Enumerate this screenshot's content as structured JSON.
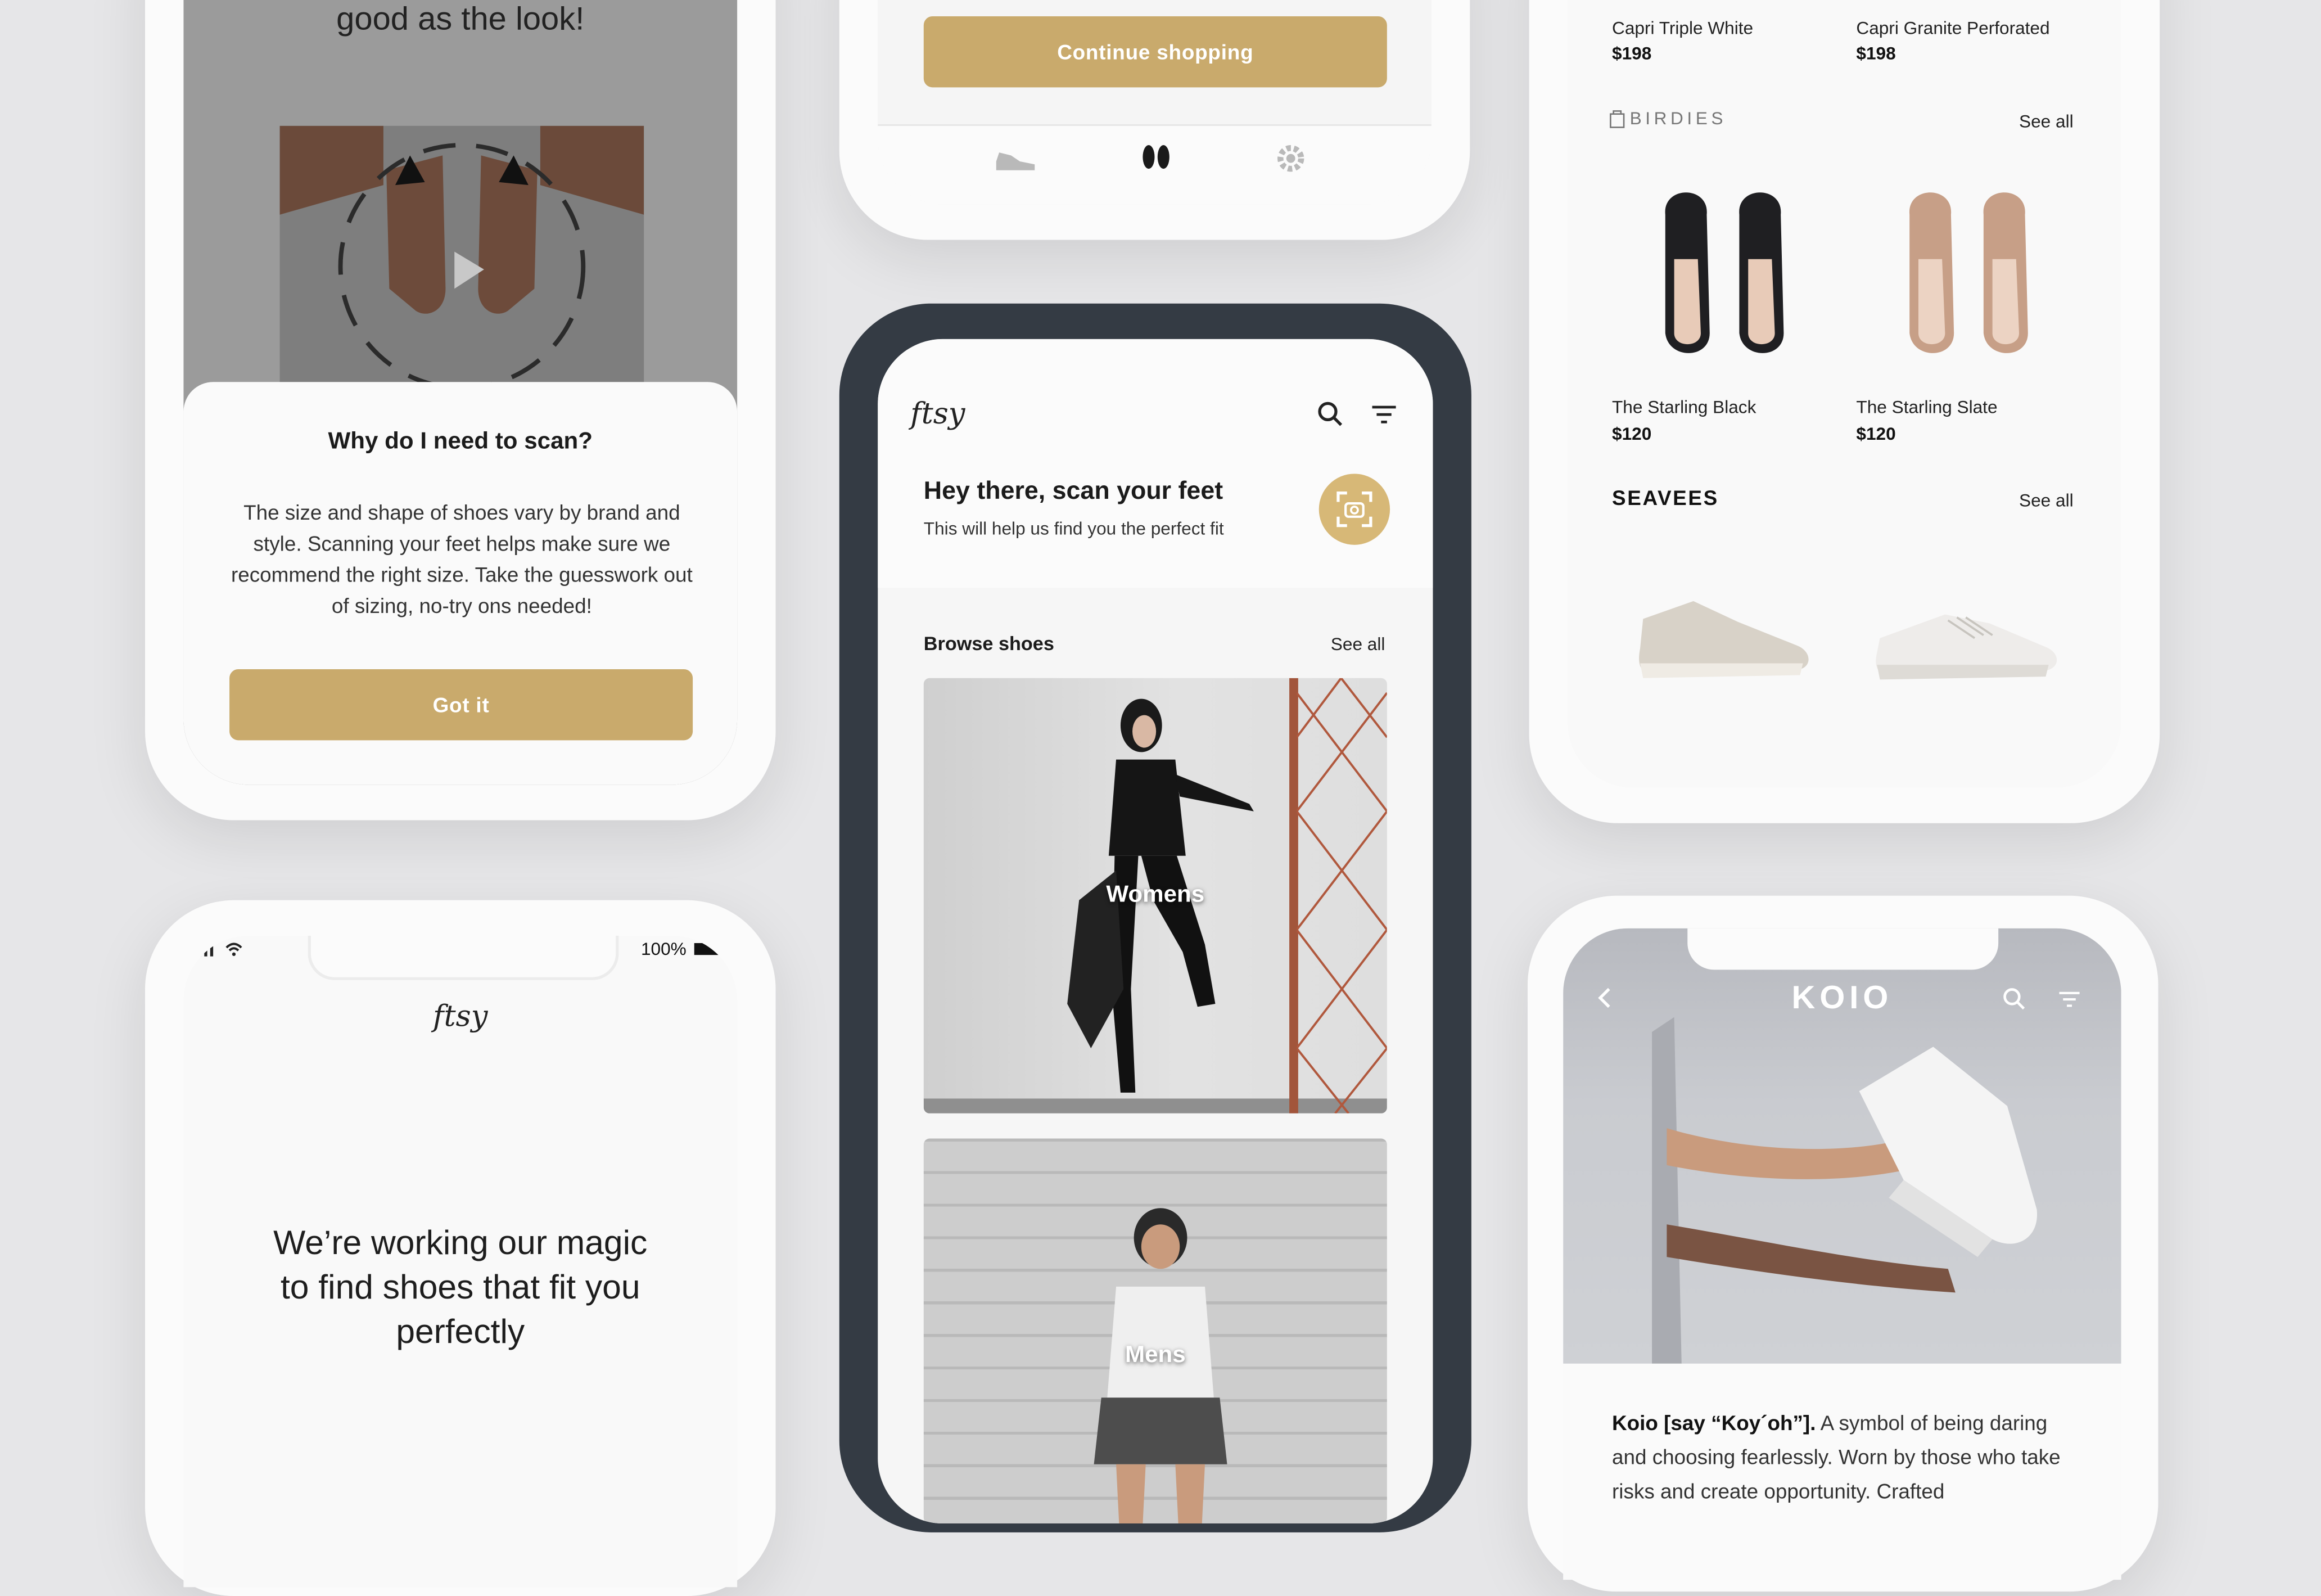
{
  "phone1": {
    "top_text": "good as the look!",
    "title": "Why do I need to scan?",
    "body": "The size and shape of shoes vary by brand and style. Scanning your feet helps make sure we recommend the right size. Take the guesswork out of sizing, no-try ons needed!",
    "button": "Got it"
  },
  "phone2": {
    "button": "Continue shopping",
    "nav_icons": [
      "shoe-icon",
      "feet-icon",
      "gear-icon"
    ]
  },
  "phone3": {
    "logo": "ftsy",
    "heading": "Hey there, scan your feet",
    "subheading": "This will help us find you the perfect fit",
    "section_title": "Browse shoes",
    "see_all": "See all",
    "categories": [
      "Womens",
      "Mens"
    ],
    "icons": [
      "search-icon",
      "filter-icon",
      "camera-scan-icon"
    ]
  },
  "phone4": {
    "products_top": [
      {
        "name": "Capri Triple White",
        "price": "$198"
      },
      {
        "name": "Capri Granite Perforated",
        "price": "$198"
      }
    ],
    "brand1": "BIRDIES",
    "brand1_see_all": "See all",
    "brand1_products": [
      {
        "name": "The Starling Black",
        "price": "$120"
      },
      {
        "name": "The Starling Slate",
        "price": "$120"
      }
    ],
    "brand2": "SEAVEES",
    "brand2_see_all": "See all"
  },
  "phone5": {
    "battery": "100%",
    "logo": "ftsy",
    "message": "We’re working our magic to find shoes that fit you perfectly"
  },
  "phone6": {
    "brand": "KOIO",
    "body_bold": "Koio [say “Koy´oh”].",
    "body": " A symbol of being daring and choosing fearlessly. Worn by those who take risks and create opportunity. Crafted"
  },
  "colors": {
    "gold": "#c9aa6c",
    "dark_frame": "#343b44",
    "background": "#e6e6e8"
  }
}
